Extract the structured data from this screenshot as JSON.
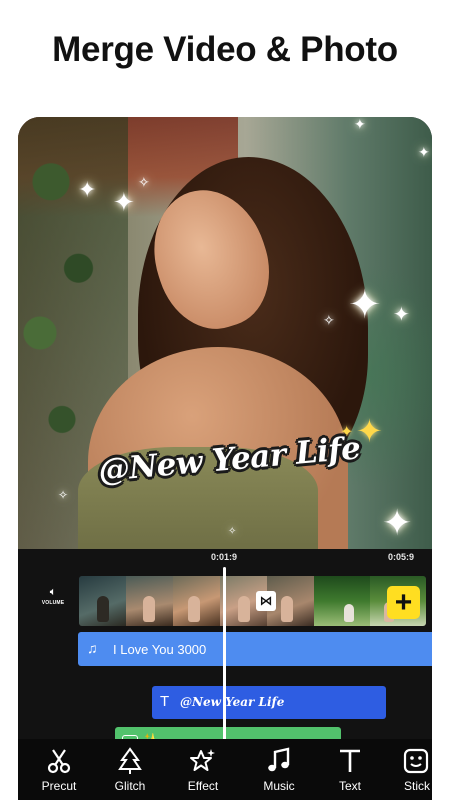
{
  "headline": "Merge Video & Photo",
  "preview": {
    "caption": "@New Year Life"
  },
  "timeline": {
    "timecode_current": "0:01:9",
    "timecode_end": "0:05:9",
    "volume_label": "VOLUME",
    "music_track_label": "I Love You 3000",
    "text_track_label": "@New Year Life",
    "add_clip_symbol": "+"
  },
  "toolbar": {
    "items": [
      {
        "label": "Precut",
        "icon": "scissors-icon"
      },
      {
        "label": "Glitch",
        "icon": "glitch-tree-icon"
      },
      {
        "label": "Effect",
        "icon": "effect-stars-icon"
      },
      {
        "label": "Music",
        "icon": "music-note-icon"
      },
      {
        "label": "Text",
        "icon": "text-t-icon"
      },
      {
        "label": "Stick",
        "icon": "sticker-icon"
      }
    ]
  },
  "colors": {
    "music_track": "#4e8cf0",
    "text_track": "#2e5de2",
    "sticker_track": "#52c26c",
    "add_button": "#ffde21"
  }
}
